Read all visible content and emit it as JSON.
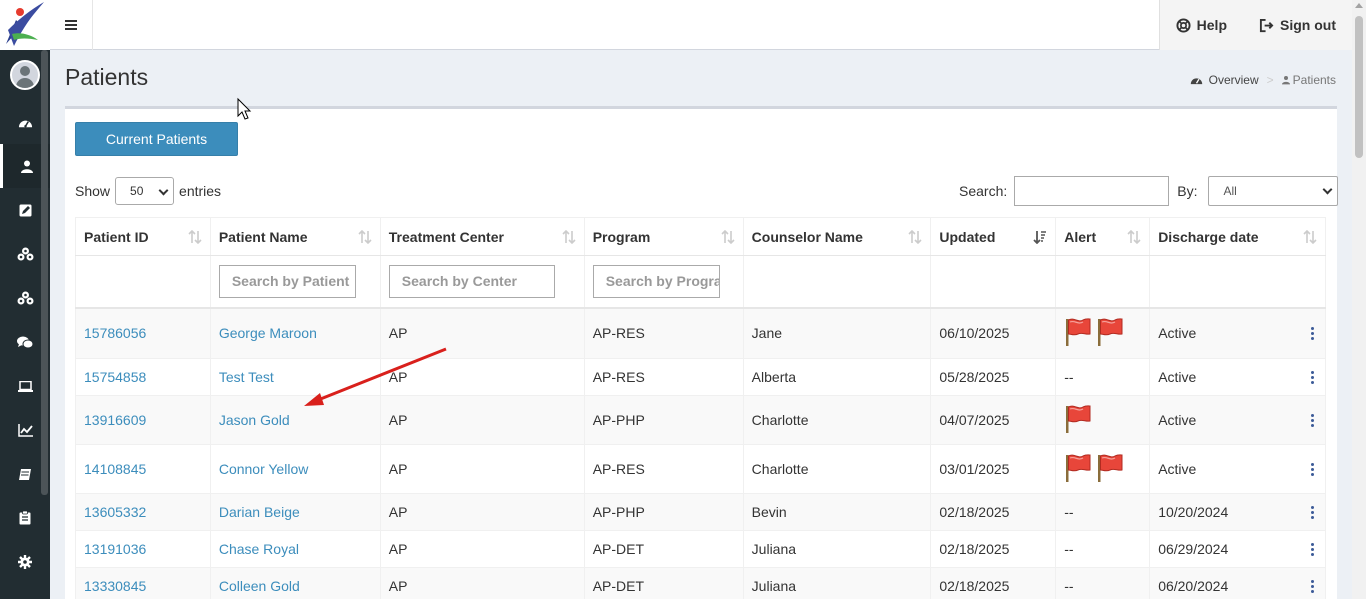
{
  "header": {
    "help_label": "Help",
    "signout_label": "Sign out"
  },
  "sidebar": {
    "items": [
      {
        "icon": "user-avatar-icon"
      },
      {
        "icon": "dashboard-icon"
      },
      {
        "icon": "user-icon",
        "active": true
      },
      {
        "icon": "edit-square-icon"
      },
      {
        "icon": "cubes-icon"
      },
      {
        "icon": "cubes-icon"
      },
      {
        "icon": "chat-icon"
      },
      {
        "icon": "laptop-icon"
      },
      {
        "icon": "line-chart-icon"
      },
      {
        "icon": "book-icon"
      },
      {
        "icon": "clipboard-icon"
      },
      {
        "icon": "gear-icon"
      }
    ]
  },
  "page": {
    "title": "Patients",
    "breadcrumb": {
      "overview": "Overview",
      "current": "Patients",
      "separator": ">"
    }
  },
  "controls": {
    "current_patients_label": "Current Patients",
    "show_label": "Show",
    "entries_value": "50",
    "entries_label": "entries",
    "search_label": "Search:",
    "search_value": "",
    "by_label": "By:",
    "by_value": "All"
  },
  "table": {
    "columns": [
      "Patient ID",
      "Patient Name",
      "Treatment Center",
      "Program",
      "Counselor Name",
      "Updated",
      "Alert",
      "Discharge date"
    ],
    "filters": {
      "patient_placeholder": "Search by Patient",
      "center_placeholder": "Search by Center",
      "program_placeholder": "Search by Progra"
    },
    "rows": [
      {
        "id": "15786056",
        "name": "George Maroon",
        "center": "AP",
        "program": "AP-RES",
        "counselor": "Jane",
        "updated": "06/10/2025",
        "alert": "",
        "flags": 2,
        "discharge": "Active"
      },
      {
        "id": "15754858",
        "name": "Test Test",
        "center": "AP",
        "program": "AP-RES",
        "counselor": "Alberta",
        "updated": "05/28/2025",
        "alert": "--",
        "flags": 0,
        "discharge": "Active"
      },
      {
        "id": "13916609",
        "name": "Jason Gold",
        "center": "AP",
        "program": "AP-PHP",
        "counselor": "Charlotte",
        "updated": "04/07/2025",
        "alert": "",
        "flags": 1,
        "discharge": "Active"
      },
      {
        "id": "14108845",
        "name": "Connor Yellow",
        "center": "AP",
        "program": "AP-RES",
        "counselor": "Charlotte",
        "updated": "03/01/2025",
        "alert": "",
        "flags": 2,
        "discharge": "Active"
      },
      {
        "id": "13605332",
        "name": "Darian Beige",
        "center": "AP",
        "program": "AP-PHP",
        "counselor": "Bevin",
        "updated": "02/18/2025",
        "alert": "--",
        "flags": 0,
        "discharge": "10/20/2024"
      },
      {
        "id": "13191036",
        "name": "Chase Royal",
        "center": "AP",
        "program": "AP-DET",
        "counselor": "Juliana",
        "updated": "02/18/2025",
        "alert": "--",
        "flags": 0,
        "discharge": "06/29/2024"
      },
      {
        "id": "13330845",
        "name": "Colleen Gold",
        "center": "AP",
        "program": "AP-DET",
        "counselor": "Juliana",
        "updated": "02/18/2025",
        "alert": "--",
        "flags": 0,
        "discharge": "06/20/2024"
      }
    ]
  },
  "colors": {
    "sidebar_bg": "#222d32",
    "primary": "#3c8dbc",
    "flag_red": "#e8463a",
    "arrow_red": "#d9201c"
  }
}
